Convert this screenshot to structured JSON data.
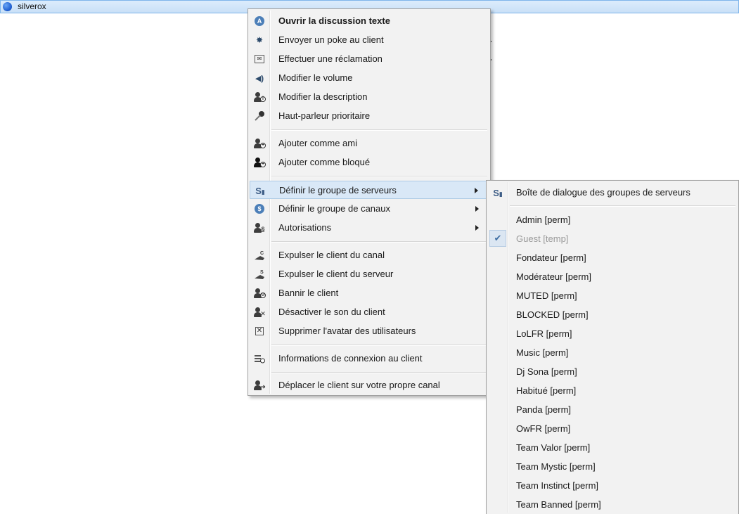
{
  "user": {
    "name": "silverox"
  },
  "main_menu": {
    "items": [
      {
        "label": "Ouvrir la discussion texte",
        "icon": "chat-bubble-icon"
      },
      {
        "label": "Envoyer un poke au client",
        "icon": "poke-icon"
      },
      {
        "label": "Effectuer une réclamation",
        "icon": "complaint-icon"
      },
      {
        "label": "Modifier le volume",
        "icon": "volume-icon"
      },
      {
        "label": "Modifier la description",
        "icon": "user-info-icon"
      },
      {
        "label": "Haut-parleur prioritaire",
        "icon": "microphone-icon"
      },
      {
        "label": "Ajouter comme ami",
        "icon": "add-friend-icon"
      },
      {
        "label": "Ajouter comme bloqué",
        "icon": "add-blocked-icon"
      },
      {
        "label": "Définir le groupe de serveurs",
        "icon": "server-group-icon"
      },
      {
        "label": "Définir le groupe de canaux",
        "icon": "channel-group-icon"
      },
      {
        "label": "Autorisations",
        "icon": "permissions-icon"
      },
      {
        "label": "Expulser le client du canal",
        "icon": "kick-channel-icon"
      },
      {
        "label": "Expulser le client du serveur",
        "icon": "kick-server-icon"
      },
      {
        "label": "Bannir le client",
        "icon": "ban-icon"
      },
      {
        "label": "Désactiver le son du client",
        "icon": "mute-client-icon"
      },
      {
        "label": "Supprimer l'avatar des utilisateurs",
        "icon": "delete-avatar-icon"
      },
      {
        "label": "Informations de connexion au client",
        "icon": "connection-info-icon"
      },
      {
        "label": "Déplacer le client sur votre propre canal",
        "icon": "move-client-icon"
      }
    ]
  },
  "sub_menu": {
    "dialog_label": "Boîte de dialogue des groupes de serveurs",
    "groups": [
      {
        "label": "Admin [perm]",
        "checked": false
      },
      {
        "label": "Guest [temp]",
        "checked": true
      },
      {
        "label": "Fondateur [perm]",
        "checked": false
      },
      {
        "label": "Modérateur [perm]",
        "checked": false
      },
      {
        "label": "MUTED [perm]",
        "checked": false
      },
      {
        "label": "BLOCKED [perm]",
        "checked": false
      },
      {
        "label": "LoLFR [perm]",
        "checked": false
      },
      {
        "label": "Music [perm]",
        "checked": false
      },
      {
        "label": "Dj Sona [perm]",
        "checked": false
      },
      {
        "label": "Habitué [perm]",
        "checked": false
      },
      {
        "label": "Panda [perm]",
        "checked": false
      },
      {
        "label": "OwFR [perm]",
        "checked": false
      },
      {
        "label": "Team Valor [perm]",
        "checked": false
      },
      {
        "label": "Team Mystic [perm]",
        "checked": false
      },
      {
        "label": "Team Instinct [perm]",
        "checked": false
      },
      {
        "label": "Team Banned [perm]",
        "checked": false
      }
    ]
  }
}
